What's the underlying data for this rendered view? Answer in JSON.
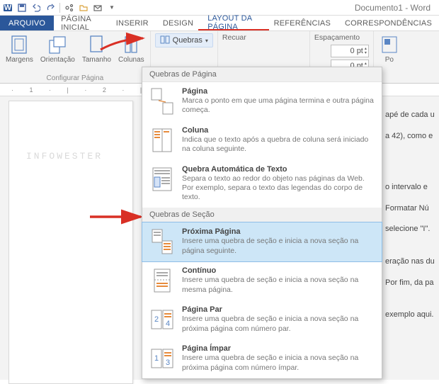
{
  "window_title": "Documento1 - Word",
  "tabs": {
    "file": "ARQUIVO",
    "home": "PÁGINA INICIAL",
    "insert": "INSERIR",
    "design": "DESIGN",
    "layout": "LAYOUT DA PÁGINA",
    "references": "REFERÊNCIAS",
    "mail": "CORRESPONDÊNCIAS"
  },
  "ribbon": {
    "margins": "Margens",
    "orientation": "Orientação",
    "size": "Tamanho",
    "columns": "Colunas",
    "group_setup": "Configurar Página",
    "breaks_btn": "Quebras",
    "indent_label": "Recuar",
    "spacing_label": "Espaçamento",
    "position_label": "Po",
    "spin_value": "0"
  },
  "panel": {
    "hdr_page": "Quebras de Página",
    "hdr_section": "Quebras de Seção",
    "pagina": {
      "title": "Página",
      "desc": "Marca o ponto em que uma página termina e outra página começa."
    },
    "coluna": {
      "title": "Coluna",
      "desc": "Indica que o texto após a quebra de coluna será iniciado na coluna seguinte."
    },
    "auto": {
      "title": "Quebra Automática de Texto",
      "desc": "Separa o texto ao redor do objeto nas páginas da Web. Por exemplo, separa o texto das legendas do corpo de texto."
    },
    "prox": {
      "title": "Próxima Página",
      "desc": "Insere uma quebra de seção e inicia a nova seção na página seguinte."
    },
    "cont": {
      "title": "Contínuo",
      "desc": "Insere uma quebra de seção e inicia a nova seção na mesma página."
    },
    "par": {
      "title": "Página Par",
      "desc": "Insere uma quebra de seção e inicia a nova seção na próxima página com número par."
    },
    "impar": {
      "title": "Página Ímpar",
      "desc": "Insere uma quebra de seção e inicia a nova seção na próxima página com número ímpar."
    }
  },
  "doc": {
    "watermark": "INFOWESTER",
    "right_lines": [
      "apé de cada u",
      "a 42), como e",
      "o intervalo e",
      "Formatar Nú",
      "selecione \"I\".",
      "eração nas du",
      "Por fim, da pa",
      "exemplo aqui."
    ],
    "ruler": "· 1 · | · 2 · | · 3"
  }
}
